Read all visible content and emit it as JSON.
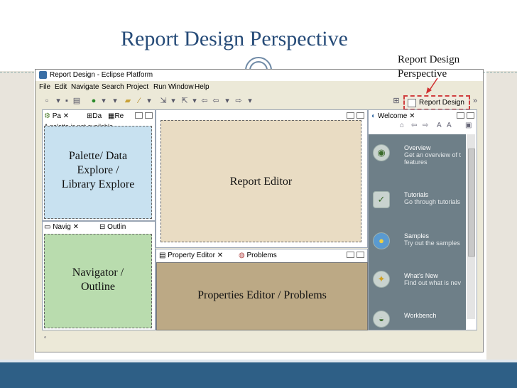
{
  "slide": {
    "title": "Report Design Perspective",
    "callout": "Report Design Perspective"
  },
  "window": {
    "title": "Report Design - Eclipse Platform",
    "menu": [
      "File",
      "Edit",
      "Navigate",
      "Search",
      "Project",
      "Run",
      "Window",
      "Help"
    ],
    "perspective_button": "Report Design",
    "chevron": "»"
  },
  "left_top_pane": {
    "tabs": [
      "Pa",
      "Da",
      "Re"
    ],
    "message": "A palette is not available.",
    "label_line1": "Palette/ Data",
    "label_line2": "Explore /",
    "label_line3": "Library Explore"
  },
  "left_bottom_pane": {
    "tabs": [
      "Navig",
      "Outlin"
    ],
    "label_line1": "Navigator /",
    "label_line2": "Outline"
  },
  "editor_pane": {
    "label": "Report Editor"
  },
  "bottom_pane": {
    "tabs": [
      "Property Editor",
      "Problems"
    ],
    "label": "Properties Editor / Problems"
  },
  "welcome_pane": {
    "tab": "Welcome",
    "items": [
      {
        "title": "Overview",
        "desc1": "Get an overview of t",
        "desc2": "features"
      },
      {
        "title": "Tutorials",
        "desc1": "Go through tutorials",
        "desc2": ""
      },
      {
        "title": "Samples",
        "desc1": "Try out the samples",
        "desc2": ""
      },
      {
        "title": "What's New",
        "desc1": "Find out what is nev",
        "desc2": ""
      },
      {
        "title": "Workbench",
        "desc1": "",
        "desc2": ""
      }
    ]
  },
  "colors": {
    "title_blue": "#264b78",
    "footer": "#2e5f86",
    "palette": "#c8e1f0",
    "editor": "#e9dcc3",
    "navigator": "#b9dcae",
    "properties": "#bca985",
    "welcome": "#6e7f88"
  }
}
